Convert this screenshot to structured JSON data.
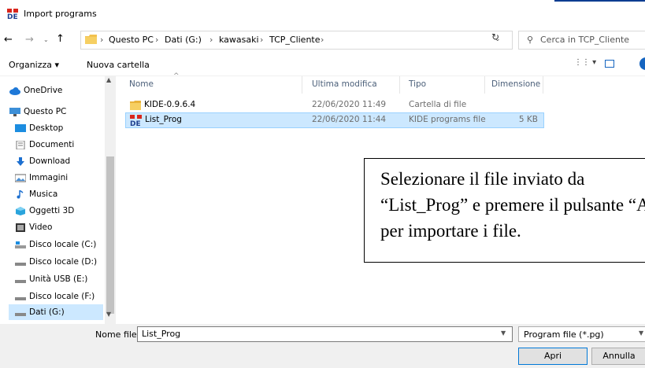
{
  "window": {
    "title": "Import programs"
  },
  "nav": {
    "back": "←",
    "forward": "→",
    "recent": "⌄",
    "up": "↑",
    "refresh": "↻"
  },
  "address": {
    "crumbs": [
      "Questo PC",
      "Dati (G:)",
      "kawasaki",
      "TCP_Cliente"
    ],
    "separator": "›",
    "dropdown": "⌄"
  },
  "search": {
    "placeholder": "Cerca in TCP_Cliente",
    "icon": "search-icon"
  },
  "toolbar": {
    "organize": "Organizza ▾",
    "new_folder": "Nuova cartella",
    "view": "⋮⋮ ▾"
  },
  "sidebar": {
    "items": [
      {
        "label": "OneDrive",
        "icon": "cloud-icon"
      },
      {
        "label": "Questo PC",
        "icon": "computer-icon"
      },
      {
        "label": "Desktop",
        "icon": "desktop-icon"
      },
      {
        "label": "Documenti",
        "icon": "documents-icon"
      },
      {
        "label": "Download",
        "icon": "download-icon"
      },
      {
        "label": "Immagini",
        "icon": "images-icon"
      },
      {
        "label": "Musica",
        "icon": "music-icon"
      },
      {
        "label": "Oggetti 3D",
        "icon": "cube-icon"
      },
      {
        "label": "Video",
        "icon": "video-icon"
      },
      {
        "label": "Disco locale (C:)",
        "icon": "drive-icon"
      },
      {
        "label": "Disco locale (D:)",
        "icon": "drive-icon"
      },
      {
        "label": "Unità USB (E:)",
        "icon": "drive-icon"
      },
      {
        "label": "Disco locale (F:)",
        "icon": "drive-icon"
      },
      {
        "label": "Dati (G:)",
        "icon": "drive-icon"
      }
    ],
    "selected": "Dati (G:)"
  },
  "columns": [
    "Nome",
    "Ultima modifica",
    "Tipo",
    "Dimensione"
  ],
  "files": [
    {
      "name": "KIDE-0.9.6.4",
      "modified": "22/06/2020 11:49",
      "type": "Cartella di file",
      "size": "",
      "icon": "folder-icon"
    },
    {
      "name": "List_Prog",
      "modified": "22/06/2020 11:44",
      "type": "KIDE programs file",
      "size": "5 KB",
      "icon": "kide-file-icon"
    }
  ],
  "annotation": {
    "line1": "Selezionare il file inviato da",
    "line2": "“List_Prog” e premere il pulsante “Apri”",
    "line3": "per importare i file."
  },
  "footer": {
    "filename_label": "Nome file:",
    "filename_value": "List_Prog",
    "filter_value": "Program file (*.pg)",
    "open_label": "Apri",
    "cancel_label": "Annulla"
  },
  "colors": {
    "selection": "#cce8ff",
    "accent": "#0078d7",
    "kide_red": "#d9261c",
    "kide_blue": "#1f3f8f"
  }
}
